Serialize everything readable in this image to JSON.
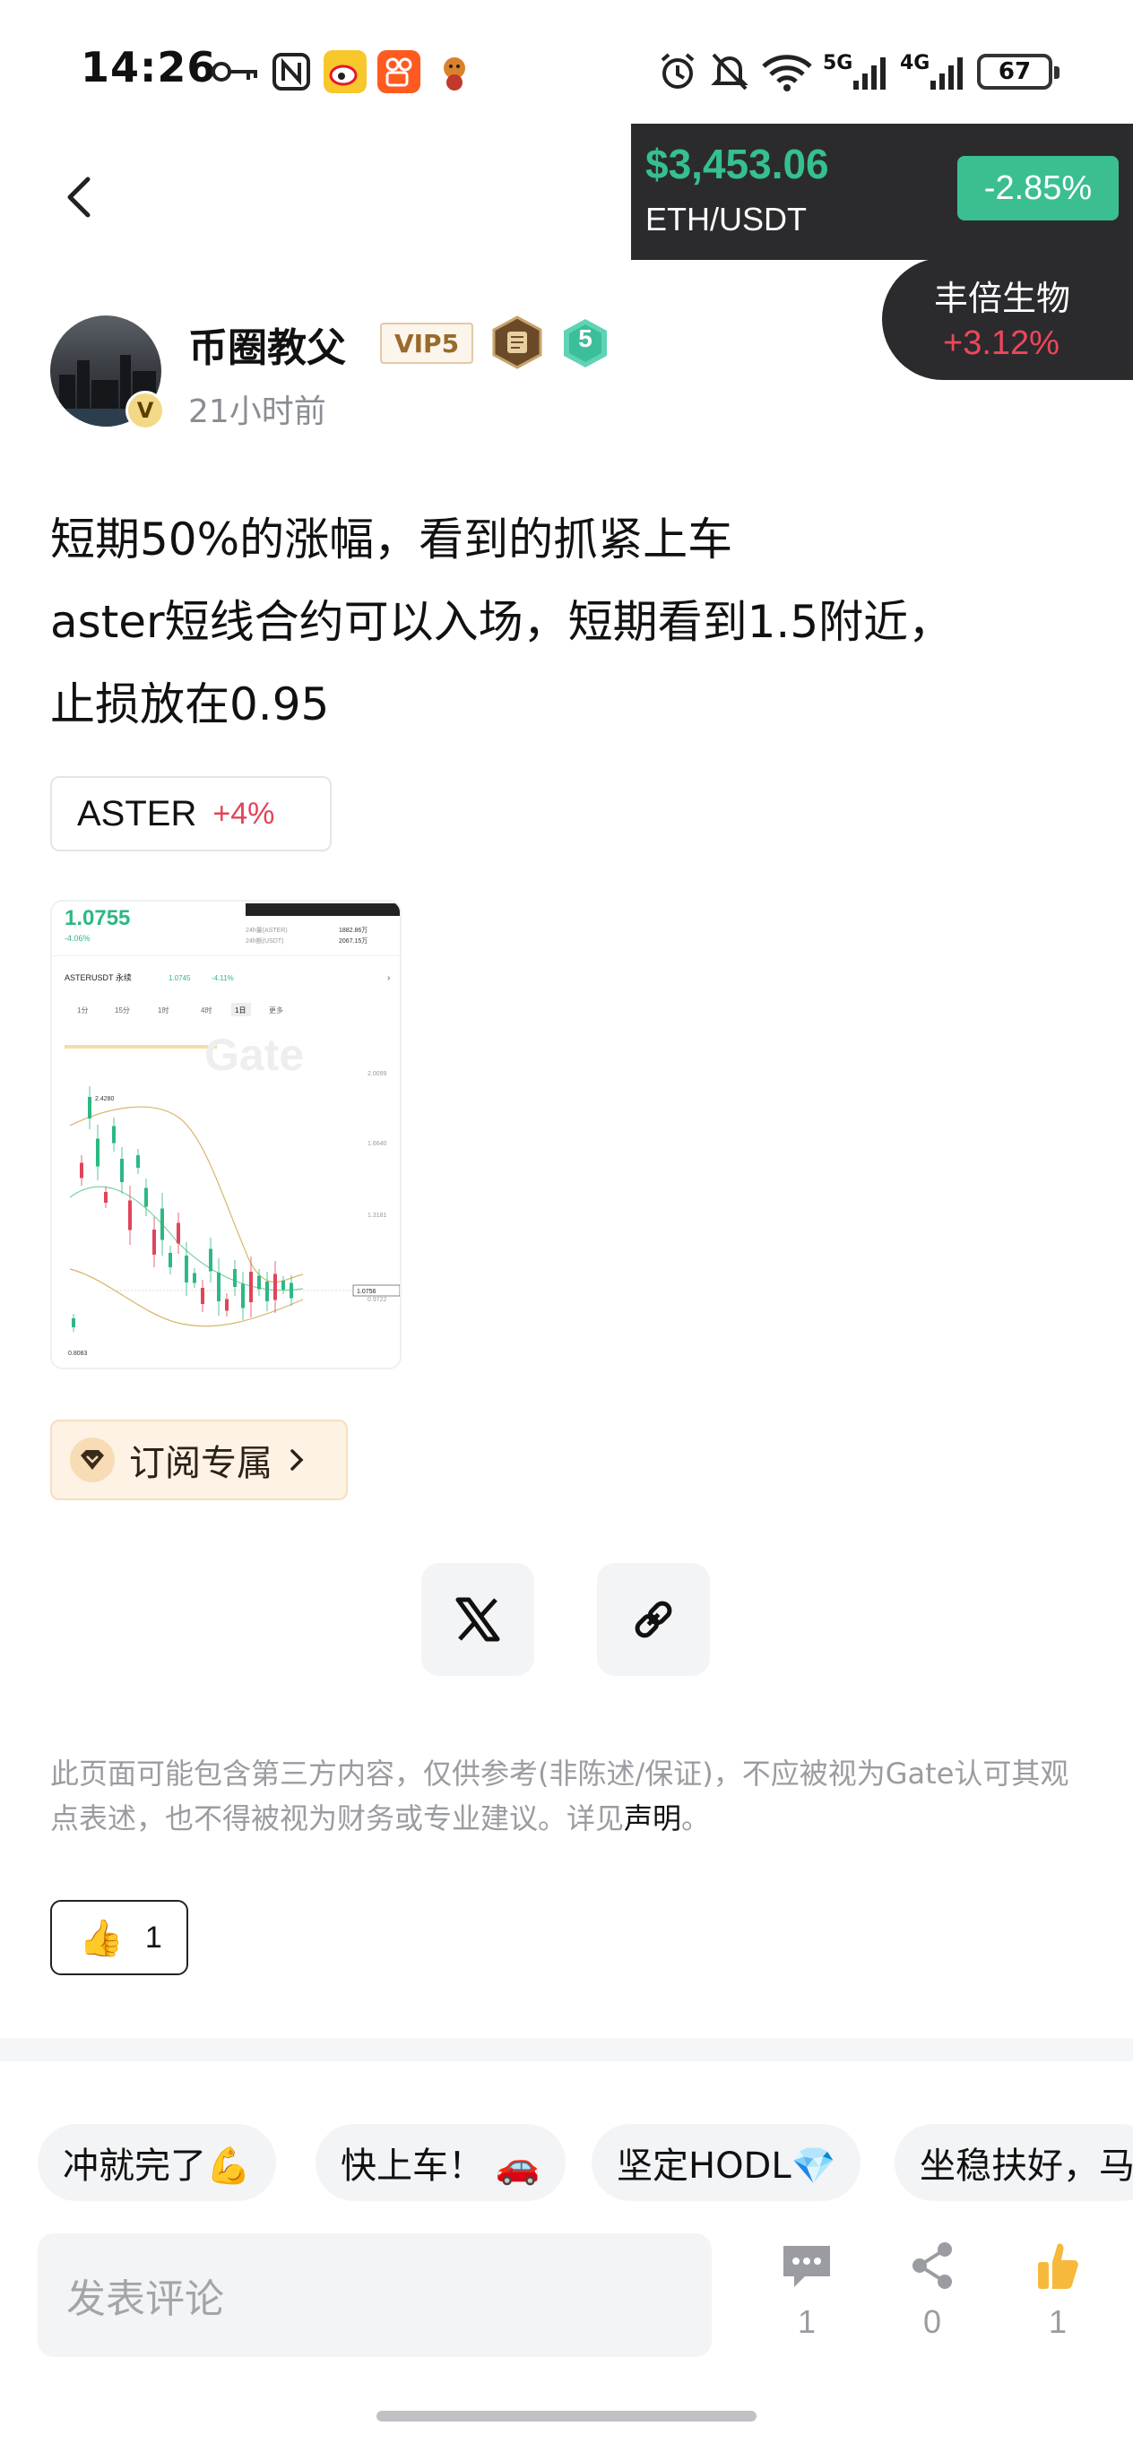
{
  "status_bar": {
    "time": "14:26",
    "network_5g": "5G",
    "network_4g": "4G",
    "battery": "67",
    "icons": [
      "key-icon",
      "nfc-icon",
      "weibo-icon",
      "kuaishou-icon",
      "app-icon",
      "alarm-icon",
      "mute-icon",
      "wifi-icon",
      "signal-icon",
      "battery-icon"
    ]
  },
  "ticker": {
    "price": "$3,453.06",
    "pair": "ETH/USDT",
    "change": "-2.85%",
    "price_color": "#35c08e",
    "change_bg": "#3bbf91"
  },
  "stock": {
    "name": "丰倍生物",
    "change": "+3.12%",
    "change_color": "#f0465a"
  },
  "author": {
    "name": "币圈教父",
    "vip": "VIP5",
    "level": "5",
    "verified": "V",
    "time": "21小时前"
  },
  "post": {
    "lines": [
      "短期50%的涨幅，看到的抓紧上车",
      "aster短线合约可以入场，短期看到1.5附近，",
      "止损放在0.95"
    ]
  },
  "coin_tag": {
    "name": "ASTER",
    "change": "+4%",
    "change_color": "#e0455a"
  },
  "thumbnail": {
    "price": "1.0755",
    "change": "-4.06%",
    "pair": "ASTERUSDT 永续",
    "pair_price": "1.0745",
    "pair_change": "-4.11%",
    "intervals": [
      "1分",
      "15分",
      "1时",
      "4时",
      "1日",
      "更多"
    ],
    "high_label": "2.4280",
    "low_label": "0.8083",
    "axis_labels": [
      "2.0099",
      "1.6640",
      "1.3181",
      "1.0756",
      "0.9722"
    ],
    "stat_rows": [
      {
        "label": "24h量(ASTER)",
        "value": "1882.86万"
      },
      {
        "label": "24h额(USDT)",
        "value": "2067.15万"
      }
    ],
    "watermark": "Gate"
  },
  "subscribe": {
    "label": "订阅专属"
  },
  "disclaimer": {
    "text": "此页面可能包含第三方内容，仅供参考(非陈述/保证)，不应被视为Gate认可其观点表述，也不得被视为财务或专业建议。详见",
    "link": "声明",
    "end": "。"
  },
  "likes": {
    "emoji": "👍",
    "count": "1"
  },
  "quick_replies": [
    "冲就完了💪",
    "快上车！ 🚗",
    "坚定HODL💎",
    "坐稳扶好，马"
  ],
  "comment": {
    "placeholder": "发表评论"
  },
  "actions": {
    "comments": "1",
    "shares": "0",
    "likes": "1"
  }
}
